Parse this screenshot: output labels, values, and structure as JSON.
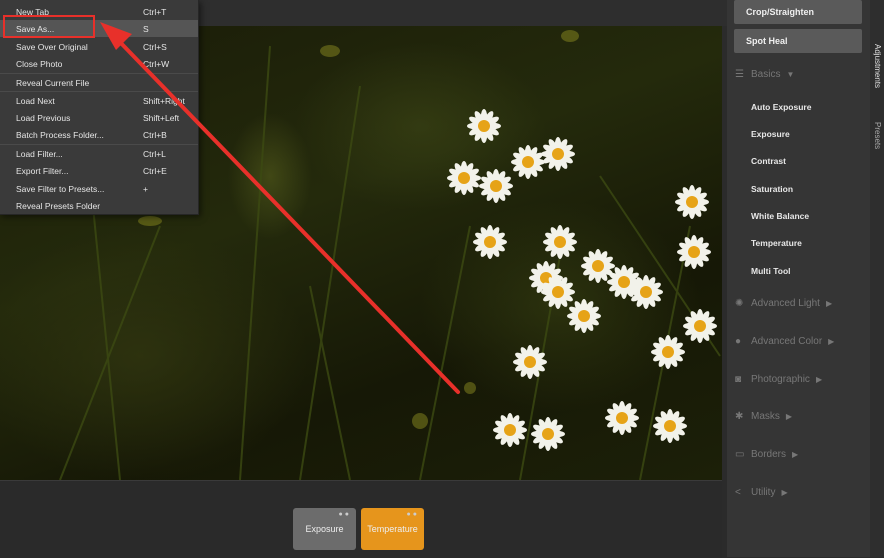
{
  "menu": {
    "items": [
      {
        "label": "New Tab",
        "shortcut": "Ctrl+T"
      },
      {
        "label": "Save As...",
        "shortcut": "S"
      },
      {
        "label": "Save Over Original",
        "shortcut": "Ctrl+S"
      },
      {
        "label": "Close Photo",
        "shortcut": "Ctrl+W"
      },
      {
        "label": "Reveal Current File",
        "shortcut": ""
      },
      {
        "label": "Load Next",
        "shortcut": "Shift+Right"
      },
      {
        "label": "Load Previous",
        "shortcut": "Shift+Left"
      },
      {
        "label": "Batch Process Folder...",
        "shortcut": "Ctrl+B"
      },
      {
        "label": "Load Filter...",
        "shortcut": "Ctrl+L"
      },
      {
        "label": "Export Filter...",
        "shortcut": "Ctrl+E"
      },
      {
        "label": "Save Filter to Presets...",
        "shortcut": "+"
      },
      {
        "label": "Reveal Presets Folder",
        "shortcut": ""
      }
    ]
  },
  "panel": {
    "crop_label": "Crop/Straighten",
    "spot_heal_label": "Spot Heal",
    "tabs": {
      "adjustments": "Adjustments",
      "presets": "Presets"
    },
    "sections": {
      "basics": "Basics",
      "advanced_light": "Advanced Light",
      "advanced_color": "Advanced Color",
      "photographic": "Photographic",
      "masks": "Masks",
      "borders": "Borders",
      "utility": "Utility"
    },
    "basic_items": [
      "Auto Exposure",
      "Exposure",
      "Contrast",
      "Saturation",
      "White Balance",
      "Temperature",
      "Multi Tool"
    ]
  },
  "filters": {
    "exposure": "Exposure",
    "temperature": "Temperature"
  },
  "colors": {
    "accent": "#e6951c",
    "annotation": "#e8302a"
  }
}
